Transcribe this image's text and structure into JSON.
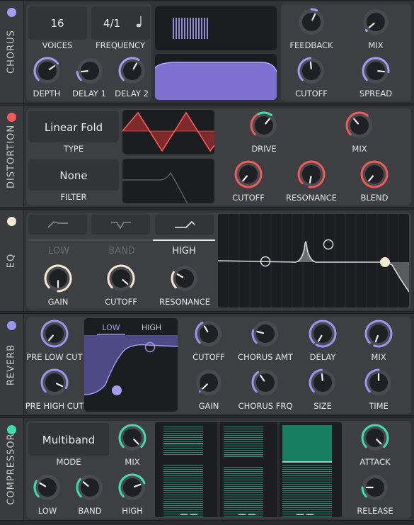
{
  "colors": {
    "chorus": "#a79cf0",
    "distortion": "#ef5a5a",
    "eq": "#f3ead4",
    "reverb": "#9c95f0",
    "compressor": "#3fdcb0"
  },
  "chorus": {
    "title": "CHORUS",
    "voices_value": "16",
    "voices_label": "VOICES",
    "frequency_value": "4/1",
    "frequency_label": "FREQUENCY",
    "note_icon": "eighth-note-icon",
    "knobs": {
      "depth": "DEPTH",
      "delay1": "DELAY 1",
      "delay2": "DELAY 2",
      "feedback": "FEEDBACK",
      "mix": "MIX",
      "cutoff": "CUTOFF",
      "spread": "SPREAD"
    }
  },
  "distortion": {
    "title": "DISTORTION",
    "type_value": "Linear Fold",
    "type_label": "TYPE",
    "filter_value": "None",
    "filter_label": "FILTER",
    "knobs": {
      "drive": "DRIVE",
      "mix": "MIX",
      "cutoff": "CUTOFF",
      "resonance": "RESONANCE",
      "blend": "BLEND"
    }
  },
  "eq": {
    "title": "EQ",
    "bands": [
      "LOW",
      "BAND",
      "HIGH"
    ],
    "selected_band": "HIGH",
    "knobs": {
      "gain": "GAIN",
      "cutoff": "CUTOFF",
      "resonance": "RESONANCE"
    }
  },
  "reverb": {
    "title": "REVERB",
    "tabs": [
      "LOW",
      "HIGH"
    ],
    "selected_tab": "LOW",
    "knobs": {
      "pre_low_cut": "PRE LOW CUT",
      "pre_high_cut": "PRE HIGH CUT",
      "cutoff": "CUTOFF",
      "chorus_amt": "CHORUS AMT",
      "delay": "DELAY",
      "mix": "MIX",
      "gain": "GAIN",
      "chorus_frq": "CHORUS FRQ",
      "size": "SIZE",
      "time": "TIME"
    }
  },
  "compressor": {
    "title": "COMPRESSOR",
    "mode_value": "Multiband",
    "mode_label": "MODE",
    "knobs": {
      "mix": "MIX",
      "low": "LOW",
      "band": "BAND",
      "high": "HIGH",
      "attack": "ATTACK",
      "release": "RELEASE"
    }
  }
}
